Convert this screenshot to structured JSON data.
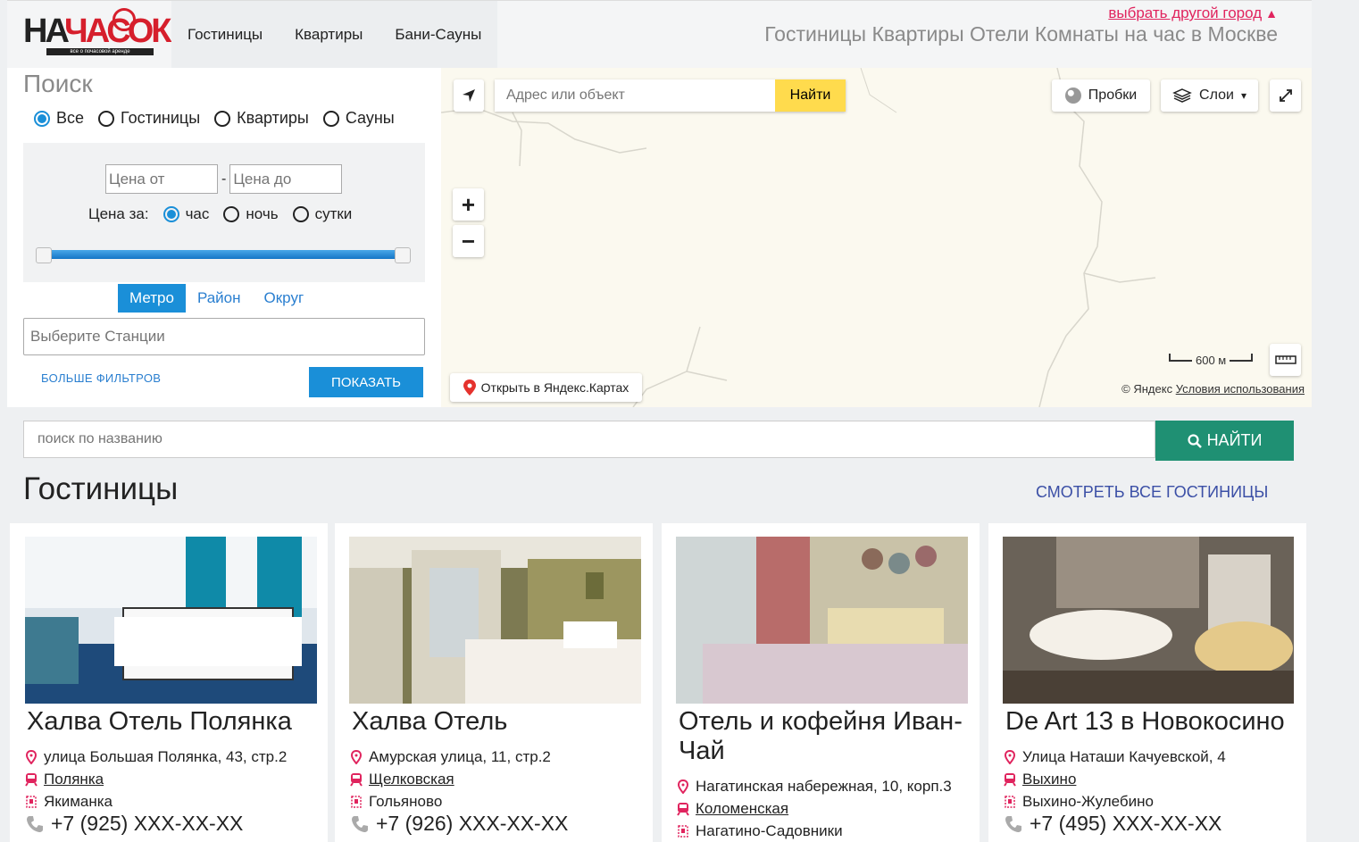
{
  "header": {
    "logo": {
      "part1": "НА",
      "part2": "ЧАСОК",
      "subtitle": "все о почасовой аренде"
    },
    "nav": [
      "Гостиницы",
      "Квартиры",
      "Бани-Сауны"
    ],
    "city_link": "выбрать другой город",
    "tagline": "Гостиницы Квартиры Отели Комнаты на час в Москве"
  },
  "search": {
    "title": "Поиск",
    "types": [
      {
        "label": "Все",
        "checked": true
      },
      {
        "label": "Гостиницы",
        "checked": false
      },
      {
        "label": "Квартиры",
        "checked": false
      },
      {
        "label": "Сауны",
        "checked": false
      }
    ],
    "price_from_placeholder": "Цена от",
    "price_to_placeholder": "Цена до",
    "price_dash": "-",
    "price_per_label": "Цена за:",
    "price_per": [
      {
        "label": "час",
        "checked": true
      },
      {
        "label": "ночь",
        "checked": false
      },
      {
        "label": "сутки",
        "checked": false
      }
    ],
    "tabs": [
      "Метро",
      "Район",
      "Округ"
    ],
    "active_tab": "Метро",
    "station_placeholder": "Выберите Станции",
    "more_filters": "БОЛЬШЕ ФИЛЬТРОВ",
    "show_button": "ПОКАЗАТЬ"
  },
  "map": {
    "address_placeholder": "Адрес или объект",
    "find_button": "Найти",
    "traffic": "Пробки",
    "layers": "Слои",
    "open_yandex": "Открыть в Яндекс.Картах",
    "scale": "600 м",
    "copyright": "© Яндекс",
    "terms": "Условия использования"
  },
  "name_search": {
    "placeholder": "поиск по названию",
    "button": "НАЙТИ"
  },
  "hotels_section": {
    "title": "Гостиницы",
    "see_all": "СМОТРЕТЬ ВСЕ ГОСТИНИЦЫ"
  },
  "hotels": [
    {
      "name": "Халва Отель Полянка",
      "address": "улица Большая Полянка, 43, стр.2",
      "metro": "Полянка",
      "district": "Якиманка",
      "phone": "+7 (925) XXX-XX-XX"
    },
    {
      "name": "Халва Отель",
      "address": "Амурская улица, 11, стр.2",
      "metro": "Щелковская",
      "district": "Гольяново",
      "phone": "+7 (926) XXX-XX-XX"
    },
    {
      "name": "Отель и кофейня Иван-Чай",
      "address": "Нагатинская набережная, 10, корп.3",
      "metro": "Коломенская",
      "district": "Нагатино-Садовники",
      "phone": ""
    },
    {
      "name": "De Art 13 в Новокосино",
      "address": "Улица Наташи Качуевской, 4",
      "metro": "Выхино",
      "district": "Выхино-Жулебино",
      "phone": "+7 (495) XXX-XX-XX"
    }
  ],
  "colors": {
    "accent": "#1a8fd8",
    "brand_red": "#d61f2c",
    "link_pink": "#e0245e",
    "find_green": "#1f9073",
    "yandex_yellow": "#ffdb4d"
  }
}
